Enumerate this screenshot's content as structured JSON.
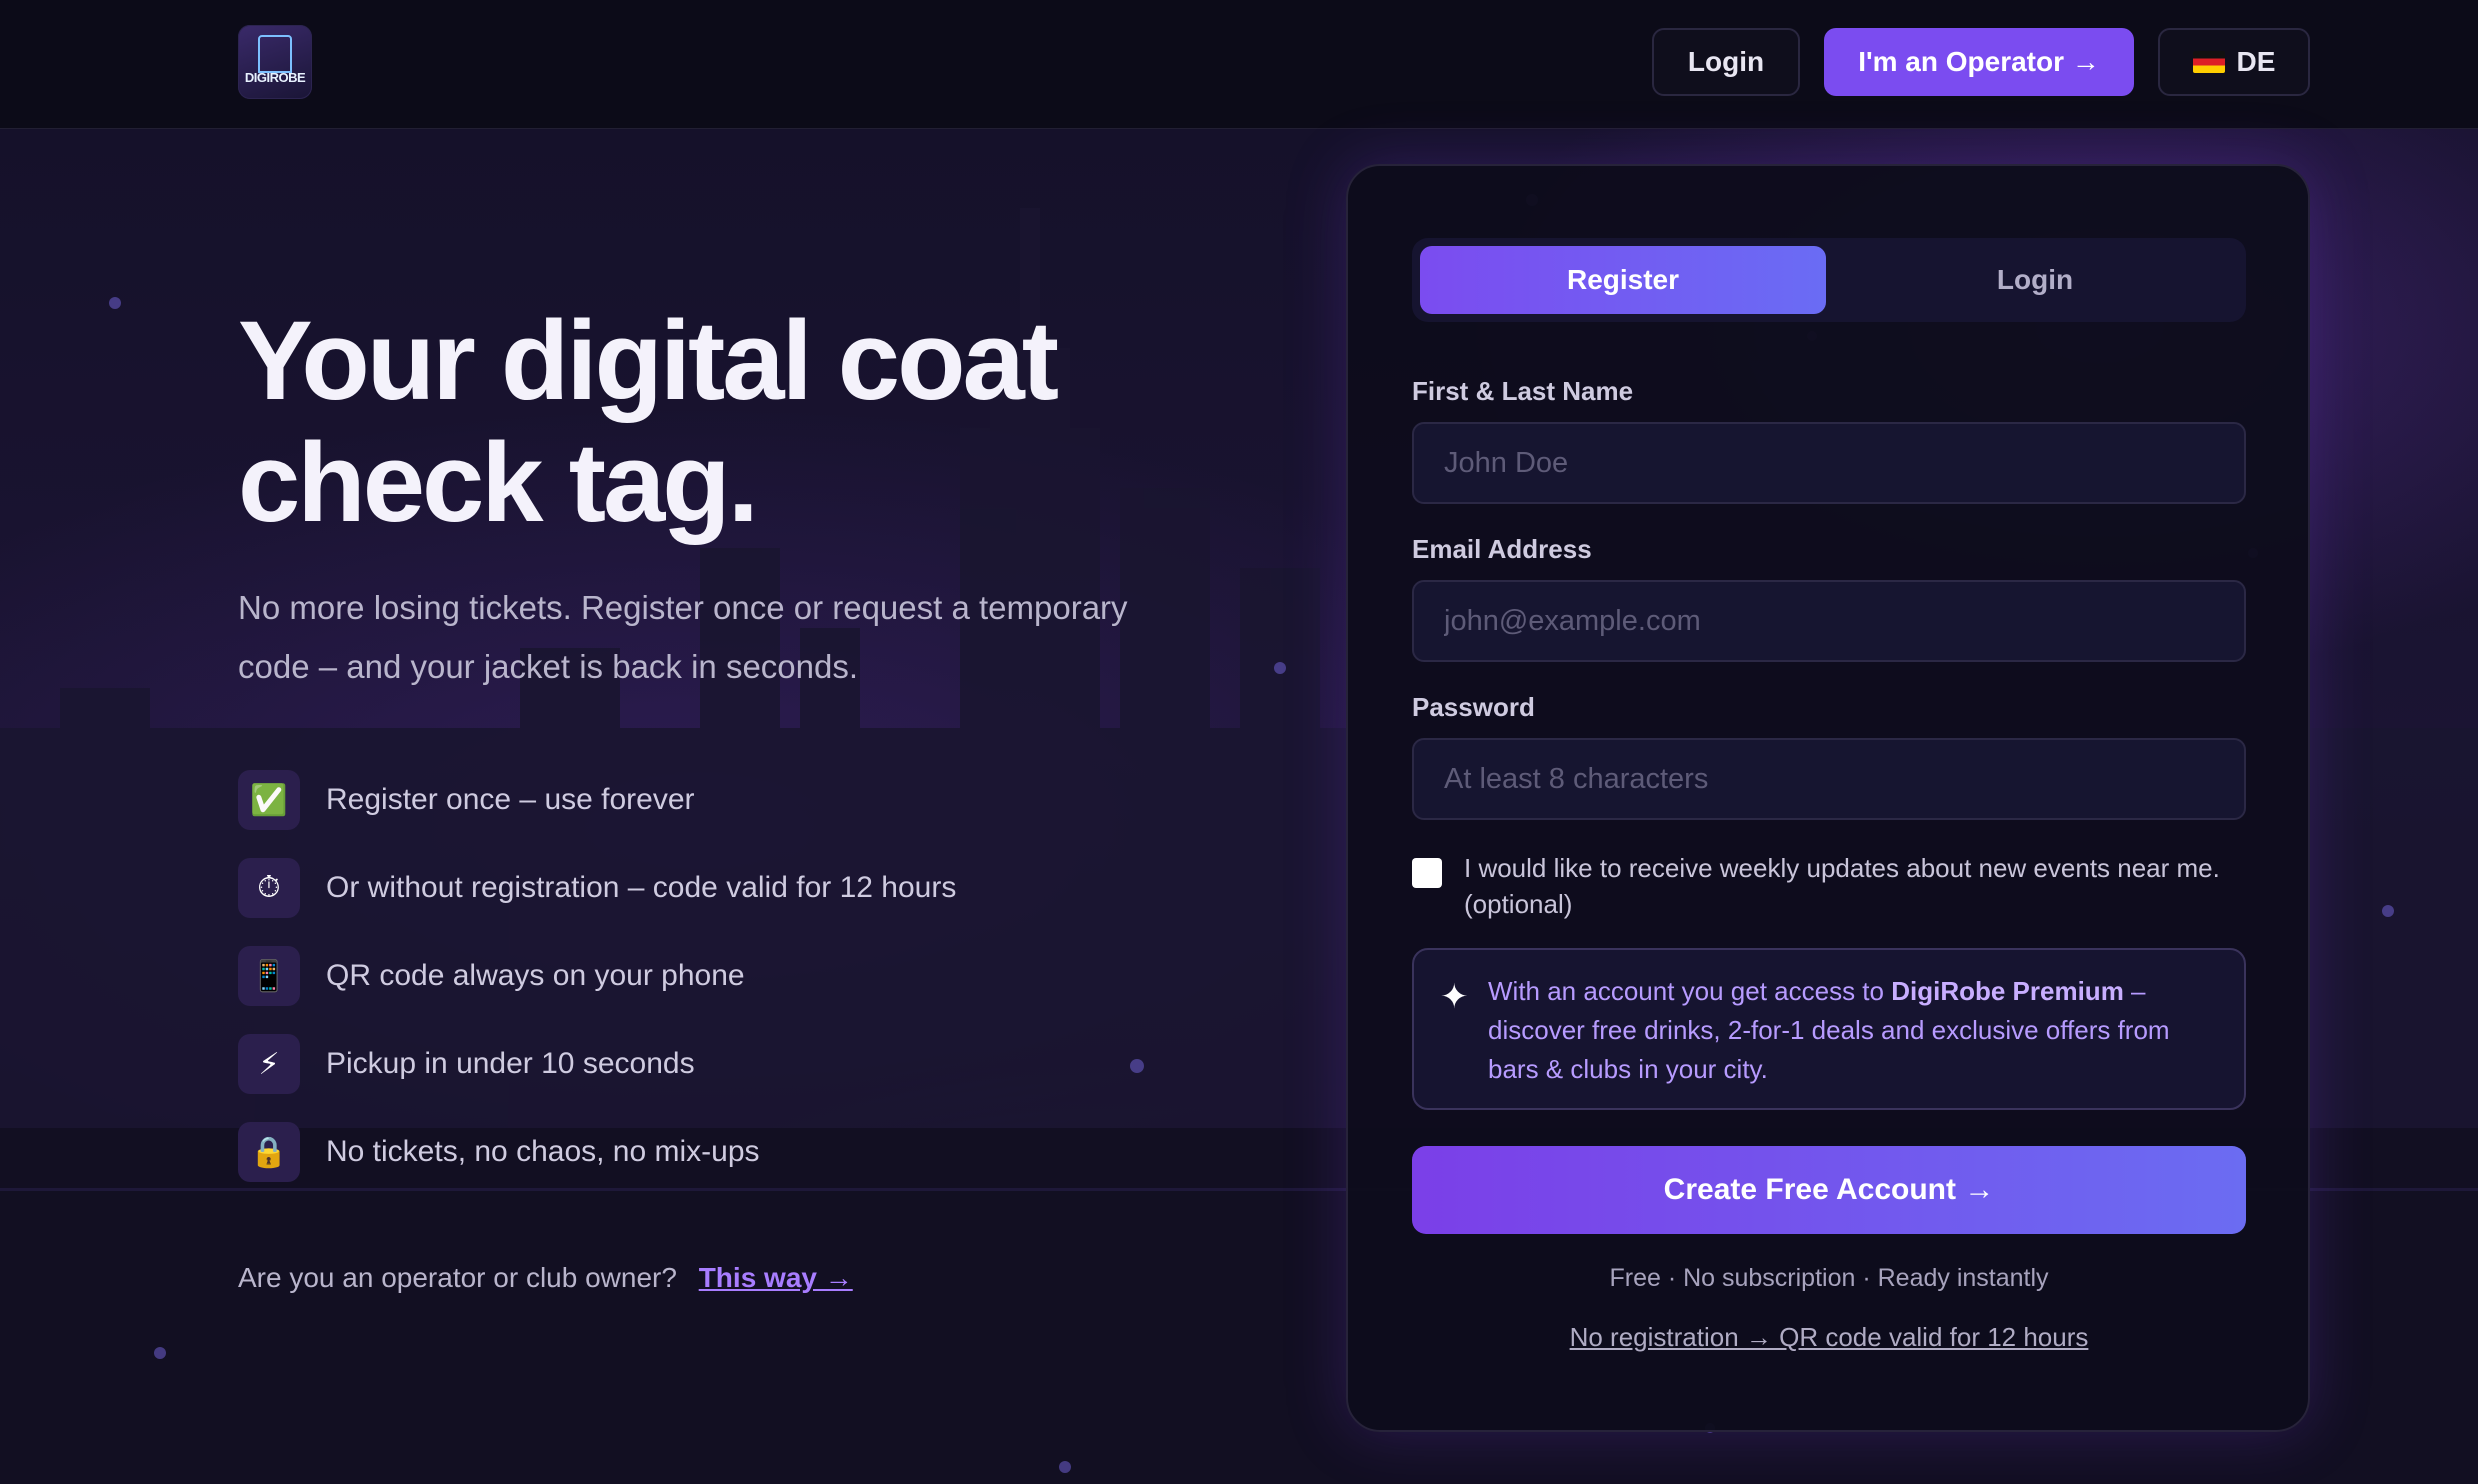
{
  "header": {
    "logo_text": "DIGIROBE",
    "login_label": "Login",
    "operator_label": "I'm an Operator →",
    "lang_label": "DE",
    "lang_flag": "flag-de-icon"
  },
  "hero": {
    "title_line1": "Your digital coat",
    "title_line2": "check tag.",
    "subtitle": "No more losing tickets. Register once or request a temporary code – and your jacket is back in seconds.",
    "features": [
      {
        "icon": "✅",
        "text": "Register once – use forever"
      },
      {
        "icon": "⏱",
        "text": "Or without registration – code valid for 12 hours"
      },
      {
        "icon": "📱",
        "text": "QR code always on your phone"
      },
      {
        "icon": "⚡",
        "text": "Pickup in under 10 seconds"
      },
      {
        "icon": "🔒",
        "text": "No tickets, no chaos, no mix-ups"
      }
    ],
    "operator_question": "Are you an operator or club owner?",
    "operator_link": "This way →"
  },
  "form": {
    "tab_register": "Register",
    "tab_login": "Login",
    "name_label": "First & Last Name",
    "name_placeholder": "John Doe",
    "email_label": "Email Address",
    "email_placeholder": "john@example.com",
    "password_label": "Password",
    "password_placeholder": "At least 8 characters",
    "newsletter_text": "I would like to receive weekly updates about new events near me. (optional)",
    "premium_prefix": "With an account you get access to ",
    "premium_brand": "DigiRobe Premium",
    "premium_suffix": " – discover free drinks, 2-for-1 deals and exclusive offers from bars & clubs in your city.",
    "cta_label": "Create Free Account →",
    "note": "Free · No subscription · Ready instantly",
    "no_reg_link": "No registration → QR code valid for 12 hours"
  },
  "colors": {
    "accent": "#7b4cf0",
    "accent_2": "#6a6cf4",
    "background": "#0d0b1c",
    "link": "#a87dff"
  }
}
